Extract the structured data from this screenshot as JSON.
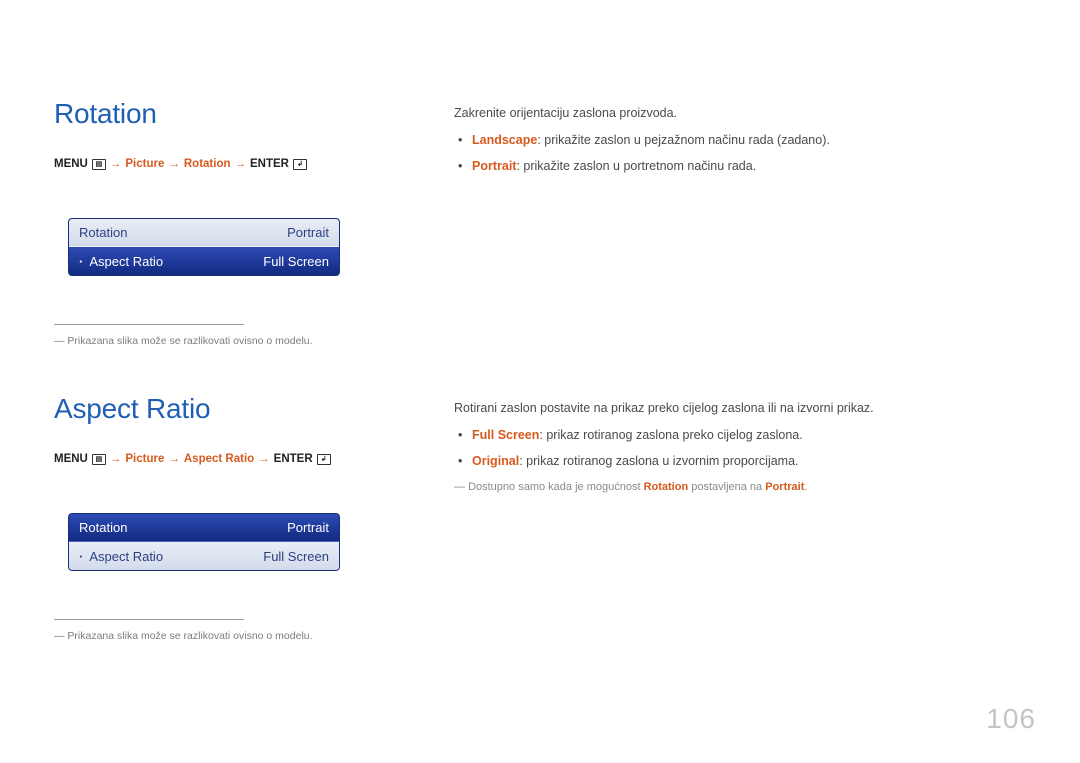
{
  "pageNumber": "106",
  "section1": {
    "title": "Rotation",
    "breadcrumb": {
      "menu": "MENU",
      "p1": "Picture",
      "p2": "Rotation",
      "enter": "ENTER"
    },
    "osd": {
      "row1": {
        "label": "Rotation",
        "value": "Portrait"
      },
      "row2": {
        "label": "Aspect Ratio",
        "value": "Full Screen"
      }
    },
    "footnote": "Prikazana slika može se razlikovati ovisno o modelu.",
    "desc": {
      "intro": "Zakrenite orijentaciju zaslona proizvoda.",
      "li1_key": "Landscape",
      "li1_txt": ": prikažite zaslon u pejzažnom načinu rada (zadano).",
      "li2_key": "Portrait",
      "li2_txt": ": prikažite zaslon u portretnom načinu rada."
    }
  },
  "section2": {
    "title": "Aspect Ratio",
    "breadcrumb": {
      "menu": "MENU",
      "p1": "Picture",
      "p2": "Aspect Ratio",
      "enter": "ENTER"
    },
    "osd": {
      "row1": {
        "label": "Rotation",
        "value": "Portrait"
      },
      "row2": {
        "label": "Aspect Ratio",
        "value": "Full Screen"
      }
    },
    "footnote": "Prikazana slika može se razlikovati ovisno o modelu.",
    "desc": {
      "intro": "Rotirani zaslon postavite na prikaz preko cijelog zaslona ili na izvorni prikaz.",
      "li1_key": "Full Screen",
      "li1_txt": ": prikaz rotiranog zaslona preko cijelog zaslona.",
      "li2_key": "Original",
      "li2_txt": ": prikaz rotiranog zaslona u izvornim proporcijama.",
      "note_pre": "Dostupno samo kada je mogućnost ",
      "note_k1": "Rotation",
      "note_mid": " postavljena na ",
      "note_k2": "Portrait",
      "note_post": "."
    }
  }
}
